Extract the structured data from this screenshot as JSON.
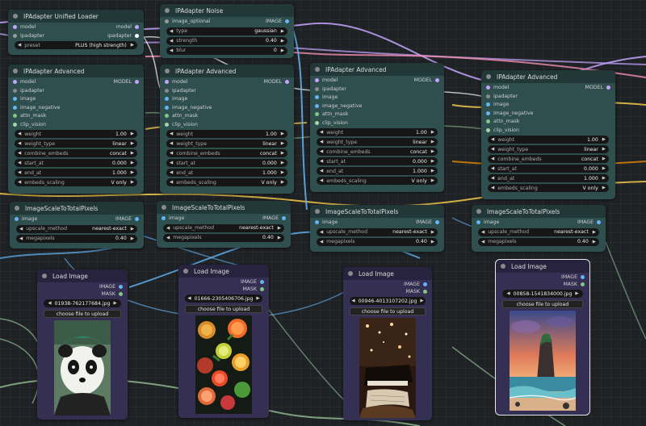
{
  "colors": {
    "canvas": "#1f2225",
    "node_body": "#2f4f4f",
    "node_header": "#223838",
    "load_body": "#352f53",
    "wire_model": "#b39ddb",
    "wire_ipadapter": "#ffffff",
    "wire_image": "#64b5f6",
    "wire_clip_vision": "#a5d6a7",
    "wire_yellow": "#ffd54f",
    "wire_pink": "#f48fb1",
    "wire_orange": "#ff9800"
  },
  "unified_loader": {
    "title": "IPAdapter Unified Loader",
    "inputs": [
      "model",
      "ipadapter"
    ],
    "outputs": [
      "model",
      "ipadapter"
    ],
    "preset_label": "preset",
    "preset_value": "PLUS (high strength)"
  },
  "noise": {
    "title": "IPAdapter Noise",
    "input": "image_optional",
    "output": "IMAGE",
    "widgets": [
      {
        "label": "type",
        "value": "gaussian"
      },
      {
        "label": "strength",
        "value": "0.40"
      },
      {
        "label": "blur",
        "value": "0"
      }
    ]
  },
  "advanced": {
    "title": "IPAdapter Advanced",
    "inputs": [
      "model",
      "ipadapter",
      "image",
      "image_negative",
      "attn_mask",
      "clip_vision"
    ],
    "output": "MODEL",
    "widgets": [
      {
        "label": "weight",
        "value": "1.00"
      },
      {
        "label": "weight_type",
        "value": "linear"
      },
      {
        "label": "combine_embeds",
        "value": "concat"
      },
      {
        "label": "start_at",
        "value": "0.000"
      },
      {
        "label": "end_at",
        "value": "1.000"
      },
      {
        "label": "embeds_scaling",
        "value": "V only"
      }
    ]
  },
  "scale": {
    "title": "ImageScaleToTotalPixels",
    "input": "image",
    "output": "IMAGE",
    "widgets": [
      {
        "label": "upscale_method",
        "value": "nearest-exact"
      },
      {
        "label": "megapixels",
        "value": "0.40"
      }
    ]
  },
  "load_images": [
    {
      "title": "Load Image",
      "outputs": [
        "IMAGE",
        "MASK"
      ],
      "file": "01938-762177684.jpg",
      "button": "choose file to upload",
      "subject": "panda"
    },
    {
      "title": "Load Image",
      "outputs": [
        "IMAGE",
        "MASK"
      ],
      "file": "01666-2305406706.jpg",
      "button": "choose file to upload",
      "subject": "fruit"
    },
    {
      "title": "Load Image",
      "outputs": [
        "IMAGE",
        "MASK"
      ],
      "file": "00946-4013107202.jpg",
      "button": "choose file to upload",
      "subject": "piano"
    },
    {
      "title": "Load Image",
      "outputs": [
        "IMAGE",
        "MASK"
      ],
      "file": "00858-1541834000.jpg",
      "button": "choose file to upload",
      "subject": "island"
    }
  ]
}
